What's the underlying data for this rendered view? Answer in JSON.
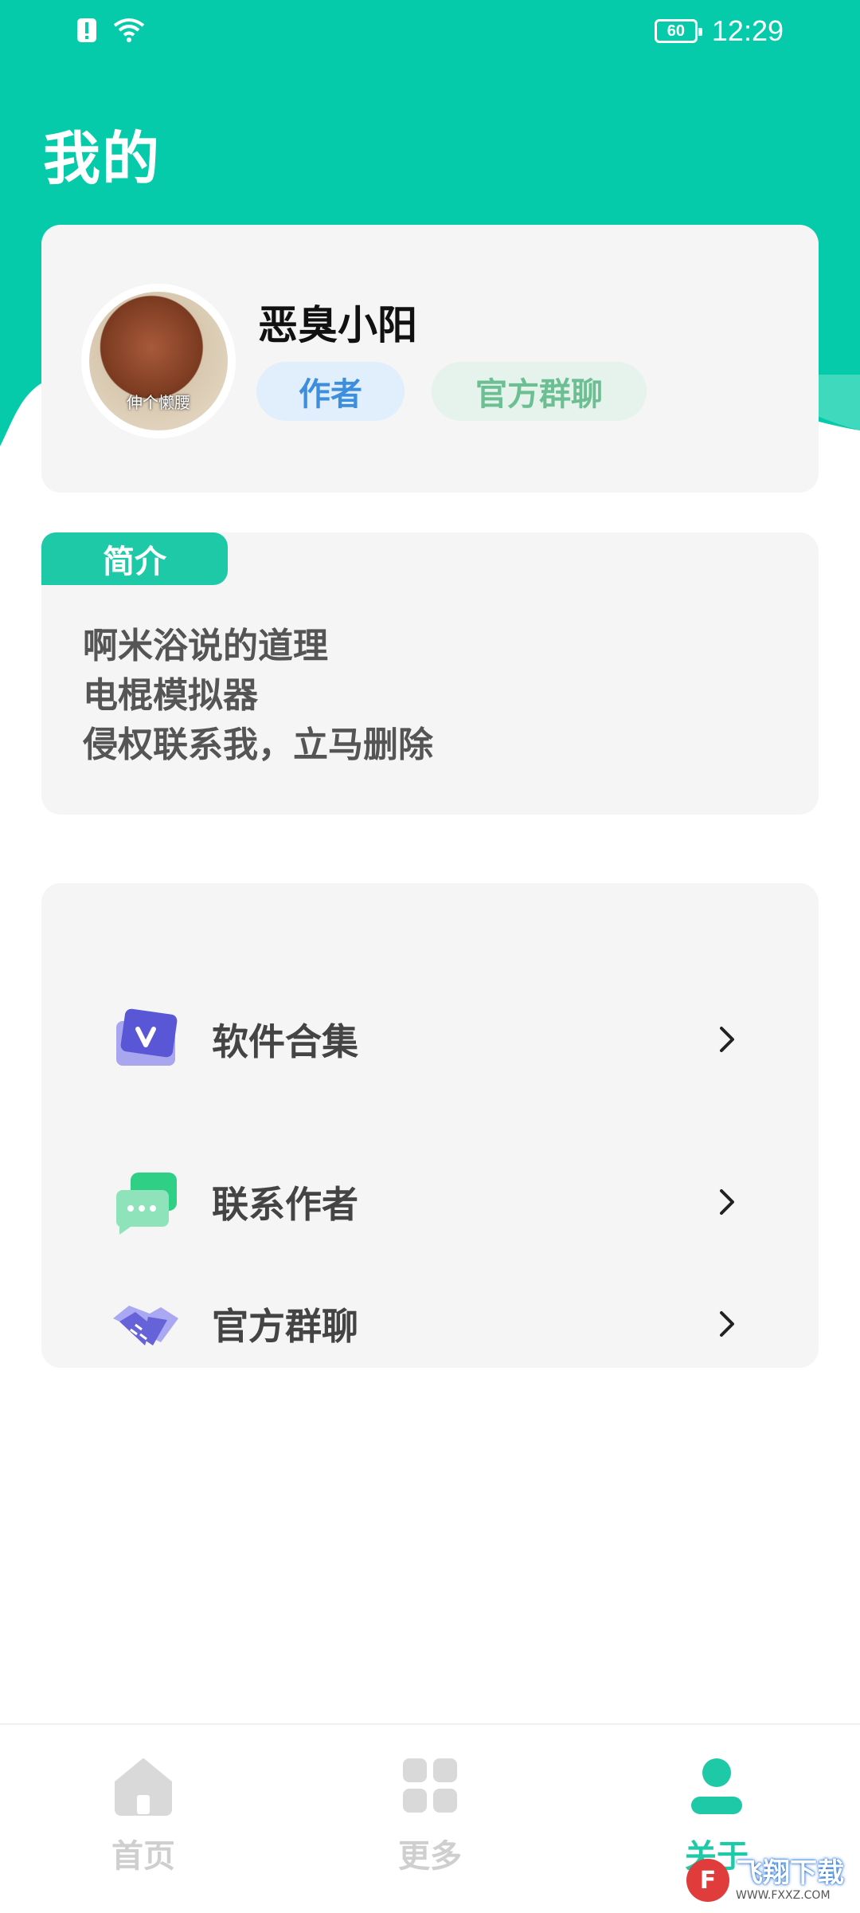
{
  "status_bar": {
    "battery": "60",
    "time": "12:29"
  },
  "header": {
    "title": "我的"
  },
  "profile": {
    "avatar_caption": "伸个懒腰",
    "username": "恶臭小阳",
    "tag_author": "作者",
    "tag_group": "官方群聊"
  },
  "intro": {
    "badge": "简介",
    "lines": [
      "啊米浴说的道理",
      "电棍模拟器",
      "侵权联系我，立马删除"
    ]
  },
  "menu": {
    "items": [
      {
        "label": "软件合集",
        "icon": "v-card-icon"
      },
      {
        "label": "联系作者",
        "icon": "chat-bubble-icon"
      },
      {
        "label": "官方群聊",
        "icon": "handshake-icon"
      }
    ]
  },
  "tabbar": {
    "tabs": [
      {
        "label": "首页",
        "icon": "home-icon",
        "active": false
      },
      {
        "label": "更多",
        "icon": "grid-icon",
        "active": false
      },
      {
        "label": "关于",
        "icon": "person-icon",
        "active": true
      }
    ]
  },
  "watermark": {
    "logo": "F",
    "main": "飞翔下载",
    "sub": "WWW.FXXZ.COM"
  },
  "colors": {
    "accent": "#1ec9a7",
    "author_tag_bg": "#e1eefb",
    "author_tag_text": "#3d8fdd",
    "group_tag_bg": "#e6f2ec",
    "group_tag_text": "#6cbf92",
    "card_bg": "#f5f5f5"
  }
}
